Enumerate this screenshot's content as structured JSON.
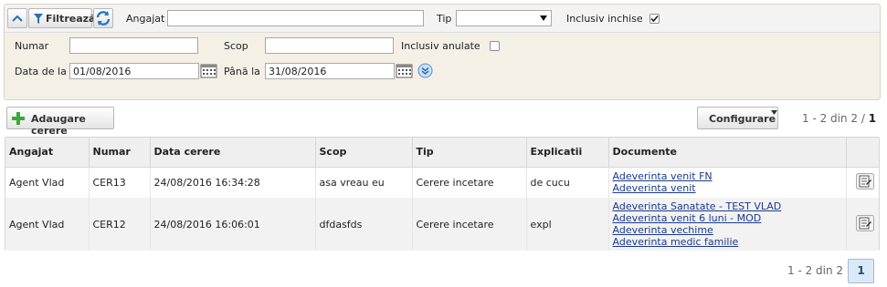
{
  "filters": {
    "filter_label": "Filtrează",
    "angajat_label": "Angajat",
    "angajat_value": "",
    "tip_label": "Tip",
    "tip_value": "",
    "inclusiv_inchise_label": "Inclusiv inchise",
    "inclusiv_inchise_checked": true,
    "numar_label": "Numar",
    "numar_value": "",
    "scop_label": "Scop",
    "scop_value": "",
    "inclusiv_anulate_label": "Inclusiv anulate",
    "inclusiv_anulate_checked": false,
    "data_de_la_label": "Data de la",
    "data_de_la_value": "01/08/2016",
    "pana_la_label": "Până la",
    "pana_la_value": "31/08/2016"
  },
  "toolbar": {
    "add_label": "Adaugare cerere",
    "configure_label": "Configurare",
    "pager_top": "1 - 2 din 2 /",
    "pager_top_page": "1"
  },
  "table": {
    "columns": [
      "Angajat",
      "Numar",
      "Data cerere",
      "Scop",
      "Tip",
      "Explicatii",
      "Documente"
    ],
    "rows": [
      {
        "angajat": "Agent Vlad",
        "numar": "CER13",
        "data": "24/08/2016 16:34:28",
        "scop": "asa vreau eu",
        "tip": "Cerere incetare",
        "explicatii": "de cucu",
        "documente": [
          "Adeverinta venit FN",
          "Adeverinta venit"
        ]
      },
      {
        "angajat": "Agent Vlad",
        "numar": "CER12",
        "data": "24/08/2016 16:06:01",
        "scop": "dfdasfds",
        "tip": "Cerere incetare",
        "explicatii": "expl",
        "documente": [
          "Adeverinta Sanatate - TEST VLAD",
          "Adeverinta venit 6 luni - MOD",
          "Adeverinta vechime",
          "Adeverinta medic familie"
        ]
      }
    ]
  },
  "pager_bottom": {
    "text": "1 - 2 din 2",
    "page": "1"
  }
}
